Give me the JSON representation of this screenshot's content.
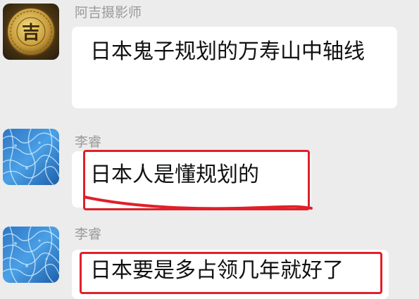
{
  "messages": [
    {
      "sender": "阿吉摄影师",
      "text": "日本鬼子规划的万寿山中轴线",
      "avatar": "coin-avatar",
      "avatar_glyph": "吉"
    },
    {
      "sender": "李睿",
      "text": "日本人是懂规划的",
      "avatar": "water-avatar",
      "highlighted": true
    },
    {
      "sender": "李睿",
      "text": "日本要是多占领几年就好了",
      "avatar": "water-avatar",
      "highlighted": true
    }
  ],
  "colors": {
    "background": "#ececec",
    "bubble": "#ffffff",
    "highlight": "#e0202a",
    "sender_name": "#9a9a9a"
  }
}
